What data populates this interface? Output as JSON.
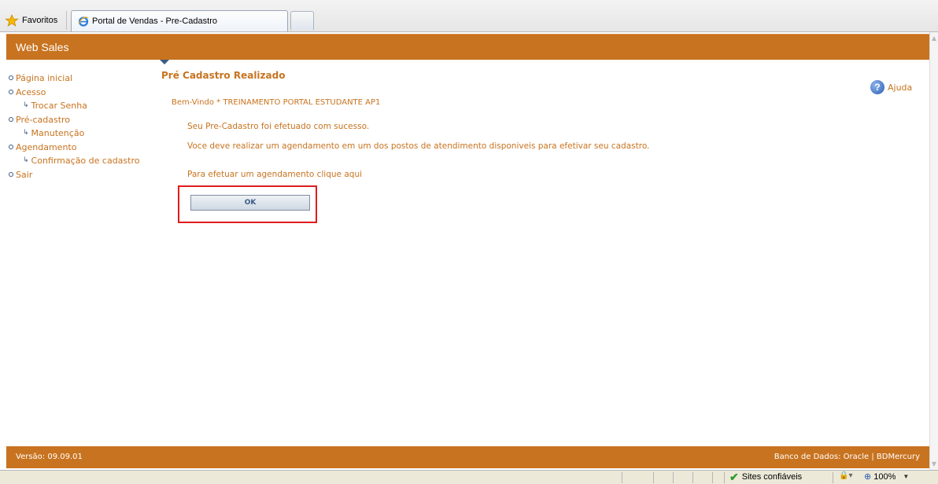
{
  "browser": {
    "favorites_label": "Favoritos",
    "tab_title": "Portal de Vendas - Pre-Cadastro"
  },
  "header": {
    "app_title": "Web Sales"
  },
  "sidebar": {
    "items": [
      {
        "label": "Página inicial"
      },
      {
        "label": "Acesso",
        "sub": [
          {
            "label": "Trocar Senha"
          }
        ]
      },
      {
        "label": "Pré-cadastro",
        "sub": [
          {
            "label": "Manutenção"
          }
        ]
      },
      {
        "label": "Agendamento",
        "sub": [
          {
            "label": "Confirmação de cadastro"
          }
        ]
      },
      {
        "label": "Sair"
      }
    ]
  },
  "main": {
    "title": "Pré Cadastro Realizado",
    "help_label": "Ajuda",
    "welcome": "Bem-Vindo * TREINAMENTO PORTAL ESTUDANTE AP1",
    "message_success": "Seu Pre-Cadastro foi efetuado com sucesso.",
    "message_instruction": "Voce deve realizar um agendamento em um dos postos de atendimento disponiveis para efetivar seu cadastro.",
    "message_link": "Para efetuar um agendamento clique aqui",
    "ok_label": "OK"
  },
  "footer": {
    "version": "Versão: 09.09.01",
    "database": "Banco de Dados: Oracle | BDMercury"
  },
  "status_bar": {
    "zone": "Sites confiáveis",
    "zoom": "100%"
  },
  "colors": {
    "accent": "#c8731f",
    "nav_icon": "#3c5a86",
    "highlight": "#e01c1c"
  }
}
